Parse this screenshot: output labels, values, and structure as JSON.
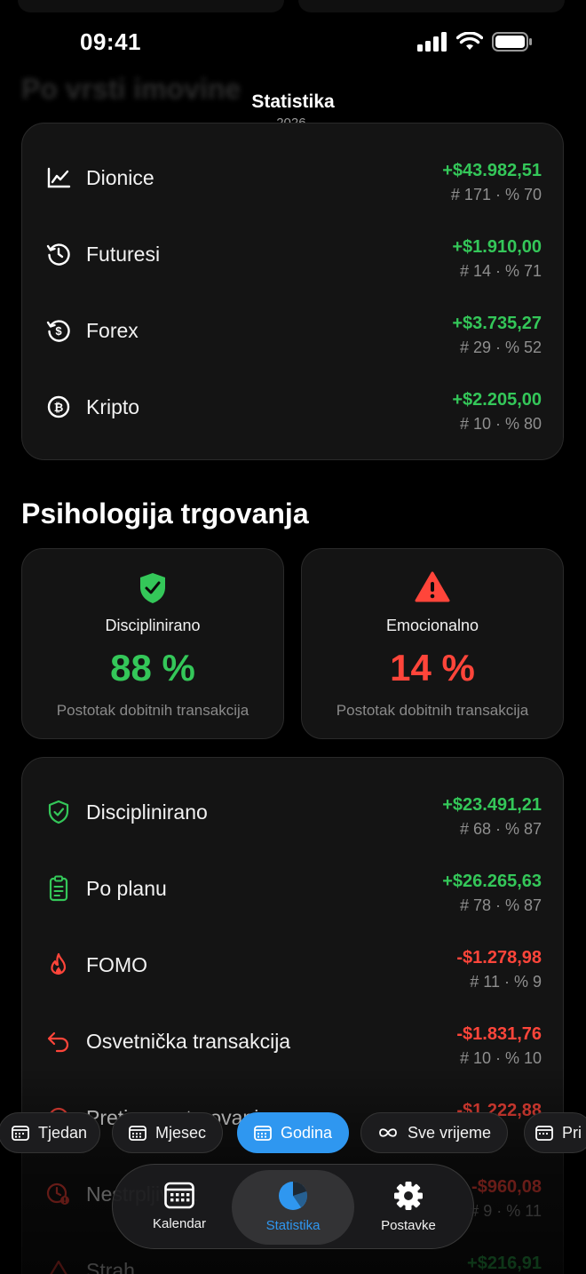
{
  "status_bar": {
    "time": "09:41"
  },
  "nav": {
    "title": "Statistika",
    "subtitle": "2026."
  },
  "background": {
    "section_title": "Po vrsti imovine"
  },
  "asset_rows": [
    {
      "icon": "line-chart-icon",
      "label": "Dionice",
      "amount": "+$43.982,51",
      "meta": "# 171 · % 70",
      "tone": "positive"
    },
    {
      "icon": "history-clock-icon",
      "label": "Futuresi",
      "amount": "+$1.910,00",
      "meta": "# 14 · % 71",
      "tone": "positive"
    },
    {
      "icon": "dollar-cycle-icon",
      "label": "Forex",
      "amount": "+$3.735,27",
      "meta": "# 29 · % 52",
      "tone": "positive"
    },
    {
      "icon": "bitcoin-icon",
      "label": "Kripto",
      "amount": "+$2.205,00",
      "meta": "# 10 · % 80",
      "tone": "positive"
    }
  ],
  "psychology": {
    "title": "Psihologija trgovanja",
    "tiles": [
      {
        "icon": "shield-check-icon",
        "label": "Disciplinirano",
        "value": "88 %",
        "sub": "Postotak dobitnih transakcija",
        "color": "#34c759"
      },
      {
        "icon": "warning-triangle-icon",
        "label": "Emocionalno",
        "value": "14 %",
        "sub": "Postotak dobitnih transakcija",
        "color": "#ff453a"
      }
    ],
    "rows": [
      {
        "icon": "shield-check-icon",
        "label": "Disciplinirano",
        "amount": "+$23.491,21",
        "meta": "# 68 · % 87",
        "tone": "positive"
      },
      {
        "icon": "clipboard-icon",
        "label": "Po planu",
        "amount": "+$26.265,63",
        "meta": "# 78 · % 87",
        "tone": "positive"
      },
      {
        "icon": "flame-icon",
        "label": "FOMO",
        "amount": "-$1.278,98",
        "meta": "# 11 · % 9",
        "tone": "negative"
      },
      {
        "icon": "undo-arrow-icon",
        "label": "Osvetnička transakcija",
        "amount": "-$1.831,76",
        "meta": "# 10 · % 10",
        "tone": "negative"
      },
      {
        "icon": "overtrading-icon",
        "label": "Pretjerano trgovanje",
        "amount": "-$1.222,88",
        "meta": "% ",
        "tone": "negative"
      },
      {
        "icon": "impatience-clock-icon",
        "label": "Nestrpljivost",
        "amount": "-$960,08",
        "meta": "# 9 · % 11",
        "tone": "negative"
      },
      {
        "icon": "fear-triangle-icon",
        "label": "Strah",
        "amount": "+$216,91",
        "meta": "",
        "tone": "positive"
      }
    ]
  },
  "period_chips": [
    {
      "label": "Tjedan",
      "active": false
    },
    {
      "label": "Mjesec",
      "active": false
    },
    {
      "label": "Godina",
      "active": true
    },
    {
      "label": "Sve vrijeme",
      "active": false
    },
    {
      "label": "Pri",
      "active": false
    }
  ],
  "tab_bar": [
    {
      "label": "Kalendar",
      "icon": "calendar-icon",
      "active": false
    },
    {
      "label": "Statistika",
      "icon": "pie-chart-icon",
      "active": true
    },
    {
      "label": "Postavke",
      "icon": "gear-icon",
      "active": false
    }
  ],
  "colors": {
    "positive": "#34c759",
    "negative": "#ff453a",
    "accent": "#2f97f0",
    "card": "#141414"
  }
}
